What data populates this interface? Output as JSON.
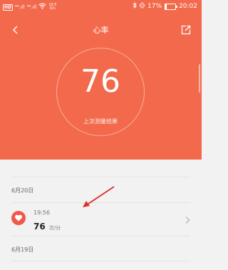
{
  "status_bar": {
    "hd": "HD",
    "signal_1": "⁴⁶.ıll",
    "signal_2": "⁴⁶.ıll",
    "net_speed_value": "10.5",
    "net_speed_unit": "K/s",
    "battery_percent": "17%",
    "battery_level": 0.17,
    "time": "20:02"
  },
  "nav": {
    "title": "心率"
  },
  "summary": {
    "value": "76",
    "caption": "上次测量结果"
  },
  "history": [
    {
      "date": "6月20日",
      "records": [
        {
          "time": "19:56",
          "value": "76",
          "unit": "次/分"
        }
      ]
    },
    {
      "date": "6月19日",
      "records": []
    }
  ],
  "colors": {
    "accent": "#f26a4b",
    "heart": "#ef5a4a",
    "annotation": "#d9302b"
  }
}
